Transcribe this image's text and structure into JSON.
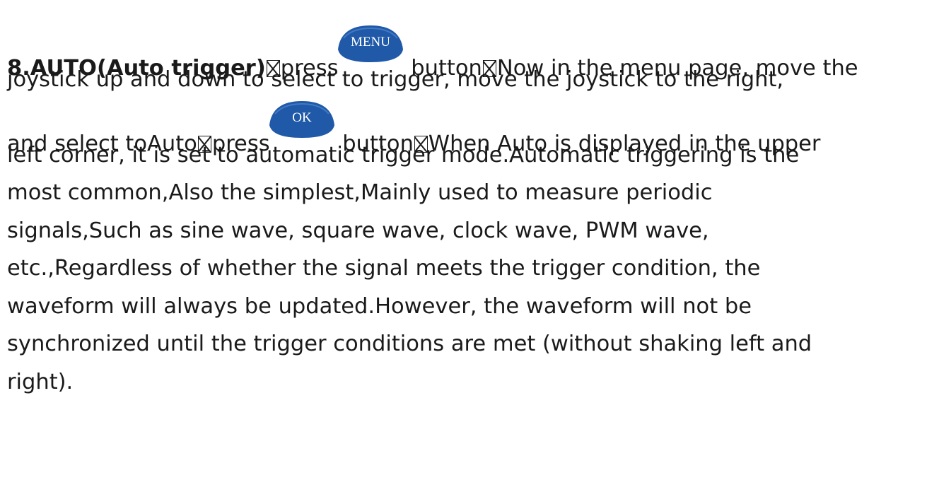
{
  "section": {
    "heading": "8.AUTO(Auto trigger)",
    "l1_after_box1": "press",
    "menu_button_label": "MENU",
    "l1_button_suffix": " button",
    "l1_after_box2": "Now in the menu page, move the",
    "line2": "joystick up and down to select to trigger, move the joystick to the right,",
    "l3_prefix": "and select toAuto",
    "l3_after_box1": "press",
    "ok_button_label": "OK",
    "l3_button_suffix": " button",
    "l3_after_box2": "When Auto is displayed in the upper",
    "line4": "left corner, it is set to automatic trigger mode.Automatic triggering is the",
    "line5": "most common,Also the simplest,Mainly used to measure periodic",
    "line6": "signals,Such as sine wave, square wave, clock wave, PWM wave,",
    "line7": "etc.,Regardless of whether the signal meets the trigger condition, the",
    "line8": "waveform will always be updated.However, the waveform will not be",
    "line9": "synchronized until the trigger conditions are met (without shaking left and",
    "line10": "right)."
  },
  "colors": {
    "text": "#1a1a1a",
    "button_fill": "#1f59a8",
    "button_label": "#ffffff"
  }
}
